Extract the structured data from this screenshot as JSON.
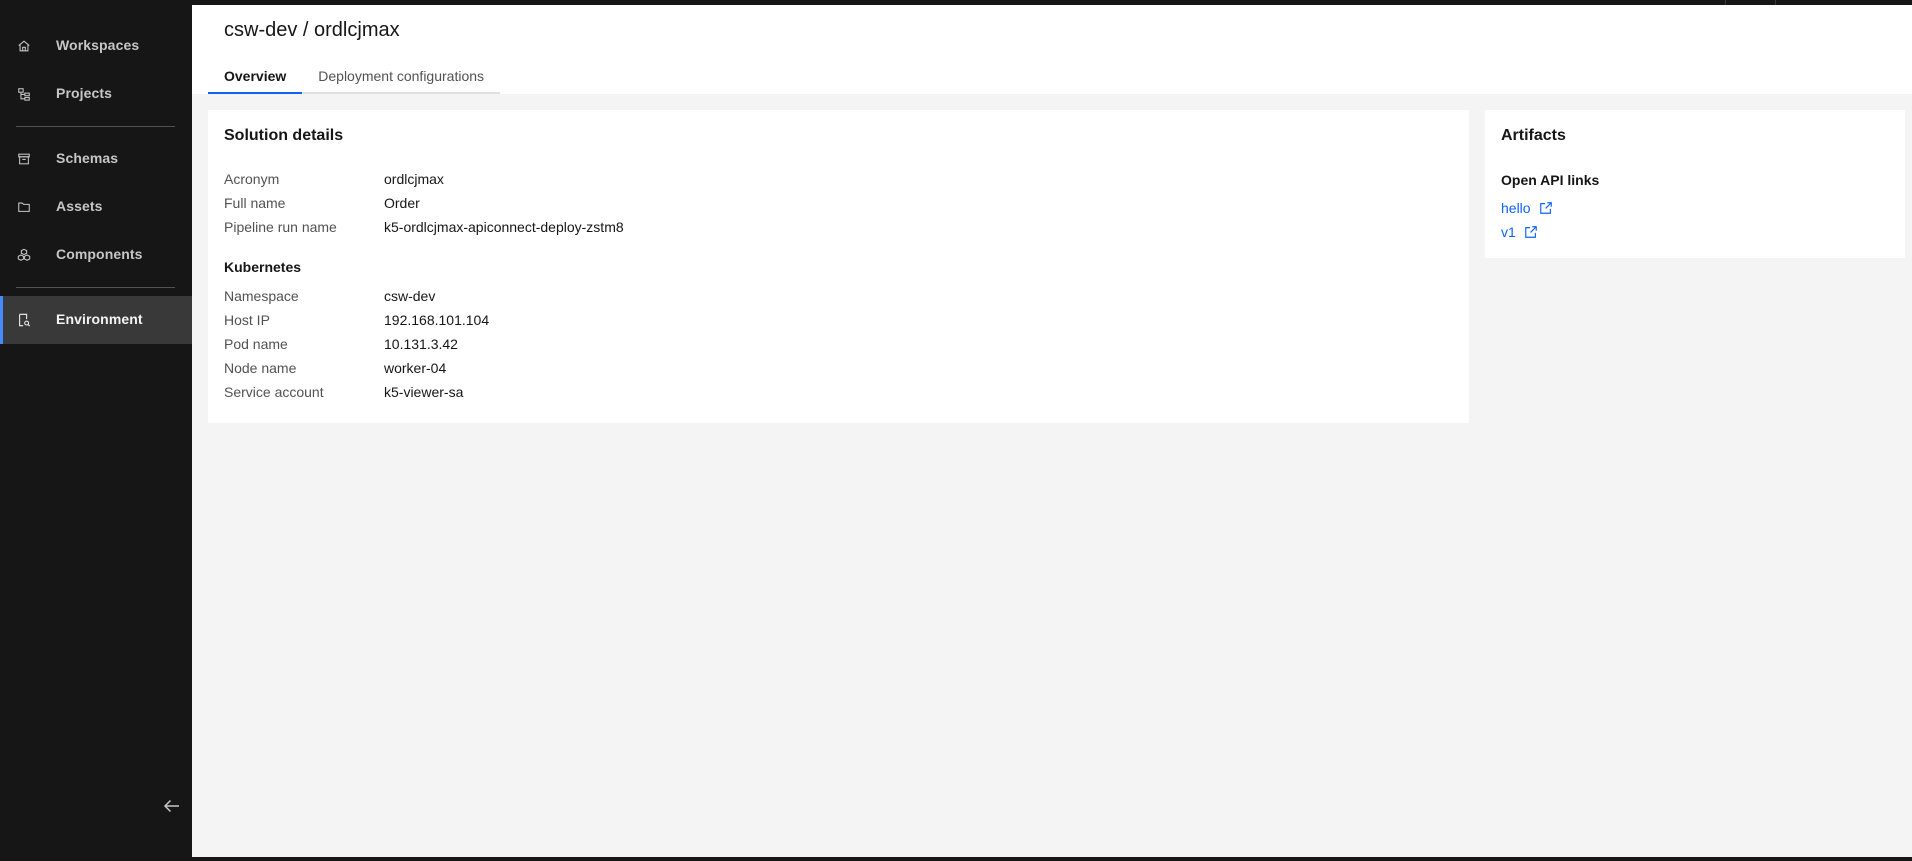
{
  "sidebar": {
    "items": [
      {
        "label": "Workspaces",
        "icon": "home-icon"
      },
      {
        "label": "Projects",
        "icon": "tree-view-icon"
      },
      {
        "label": "Schemas",
        "icon": "archive-icon"
      },
      {
        "label": "Assets",
        "icon": "folder-icon"
      },
      {
        "label": "Components",
        "icon": "cubes-icon"
      },
      {
        "label": "Environment",
        "icon": "document-view-icon",
        "active": true
      }
    ],
    "collapse_icon": "arrow-left-icon"
  },
  "header": {
    "title": "csw-dev / ordlcjmax",
    "tabs": [
      {
        "label": "Overview",
        "selected": true
      },
      {
        "label": "Deployment configurations",
        "selected": false
      }
    ]
  },
  "solution_details": {
    "title": "Solution details",
    "rows": [
      {
        "key": "Acronym",
        "value": "ordlcjmax"
      },
      {
        "key": "Full name",
        "value": "Order"
      },
      {
        "key": "Pipeline run name",
        "value": "k5-ordlcjmax-apiconnect-deploy-zstm8"
      }
    ],
    "kubernetes": {
      "title": "Kubernetes",
      "rows": [
        {
          "key": "Namespace",
          "value": "csw-dev"
        },
        {
          "key": "Host IP",
          "value": "192.168.101.104"
        },
        {
          "key": "Pod name",
          "value": "10.131.3.42"
        },
        {
          "key": "Node name",
          "value": "worker-04"
        },
        {
          "key": "Service account",
          "value": "k5-viewer-sa"
        }
      ]
    }
  },
  "artifacts": {
    "title": "Artifacts",
    "section_title": "Open API links",
    "links": [
      {
        "label": "hello",
        "icon": "launch-icon"
      },
      {
        "label": "v1",
        "icon": "launch-icon"
      }
    ]
  },
  "colors": {
    "sidebar_bg": "#161616",
    "active_indicator": "#4589ff",
    "link": "#0f62fe",
    "page_bg": "#f4f4f4"
  }
}
